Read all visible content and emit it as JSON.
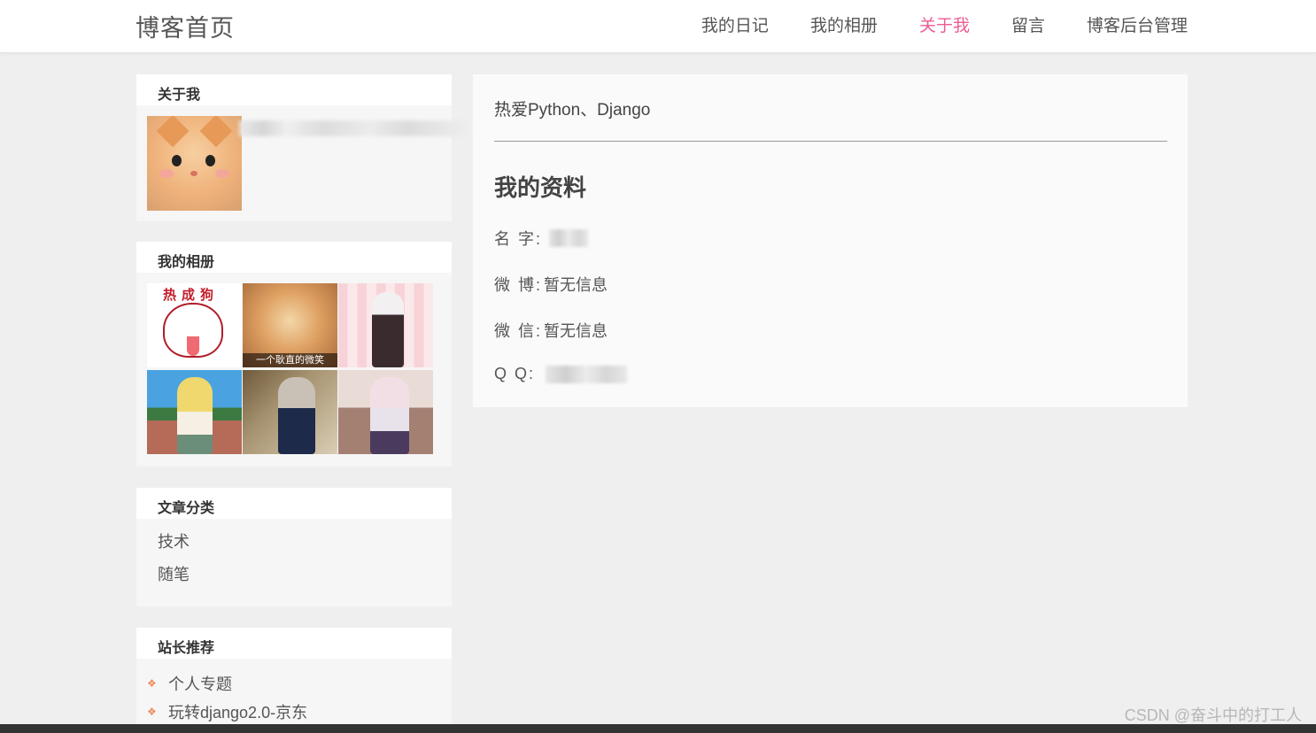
{
  "header": {
    "logo": "博客首页",
    "nav": [
      {
        "label": "我的日记"
      },
      {
        "label": "我的相册"
      },
      {
        "label": "关于我",
        "active": true
      },
      {
        "label": "留言"
      },
      {
        "label": "博客后台管理"
      }
    ]
  },
  "sidebar": {
    "about": {
      "title": "关于我"
    },
    "album": {
      "title": "我的相册",
      "thumbs": [
        {
          "caption": "热成狗"
        },
        {
          "caption": "一个耿直的微笑"
        },
        {},
        {},
        {},
        {}
      ]
    },
    "categories": {
      "title": "文章分类",
      "items": [
        "技术",
        "随笔"
      ]
    },
    "recommend": {
      "title": "站长推荐",
      "items": [
        "个人专题",
        "玩转django2.0-京东"
      ]
    }
  },
  "profile": {
    "intro": "热爱Python、Django",
    "heading": "我的资料",
    "fields": [
      {
        "label": "名 字:",
        "value": ""
      },
      {
        "label": "微 博:",
        "value": "暂无信息"
      },
      {
        "label": "微 信:",
        "value": "暂无信息"
      },
      {
        "label": "Q Q:",
        "value": ""
      }
    ]
  },
  "watermark": "CSDN @奋斗中的打工人",
  "colors": {
    "accent": "#ee5b93",
    "background": "#efefef",
    "bullet": "#f08a5d"
  }
}
